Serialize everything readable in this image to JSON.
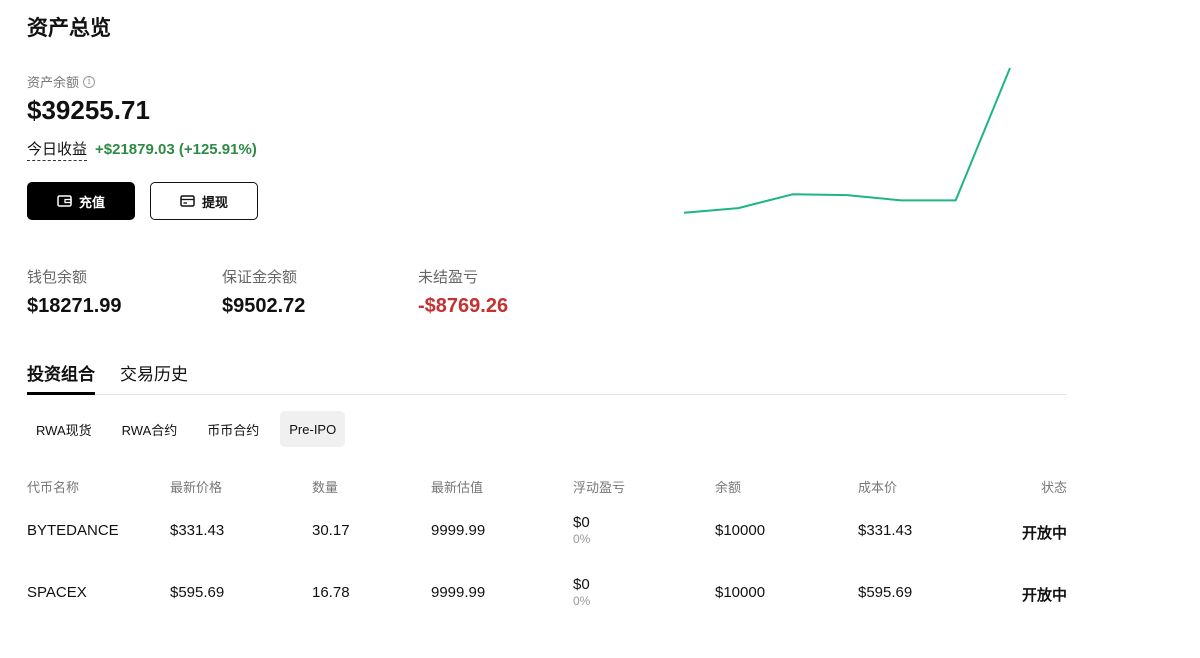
{
  "page": {
    "title": "资产总览"
  },
  "balance": {
    "label": "资产余额",
    "info_icon": "i",
    "value": "$39255.71",
    "today_pnl_label": "今日收益",
    "today_pnl_value": "+$21879.03 (+125.91%)"
  },
  "actions": {
    "deposit_label": "充值",
    "withdraw_label": "提现"
  },
  "stats": {
    "wallet_label": "钱包余额",
    "wallet_value": "$18271.99",
    "margin_label": "保证金余额",
    "margin_value": "$9502.72",
    "unrealized_label": "未结盈亏",
    "unrealized_value": "-$8769.26"
  },
  "colors": {
    "positive": "#2e8b45",
    "negative": "#c53030",
    "sparkline": "#1db588"
  },
  "sparkline": {
    "values": [
      0.06,
      0.09,
      0.18,
      0.175,
      0.14,
      0.14,
      1.0
    ]
  },
  "tabs": [
    {
      "label": "投资组合",
      "active": true
    },
    {
      "label": "交易历史",
      "active": false
    }
  ],
  "subtabs": [
    {
      "label": "RWA现货",
      "active": false
    },
    {
      "label": "RWA合约",
      "active": false
    },
    {
      "label": "币币合约",
      "active": false
    },
    {
      "label": "Pre-IPO",
      "active": true
    }
  ],
  "table": {
    "headers": [
      "代币名称",
      "最新价格",
      "数量",
      "最新估值",
      "浮动盈亏",
      "余额",
      "成本价",
      "状态"
    ],
    "rows": [
      {
        "name": "BYTEDANCE",
        "price": "$331.43",
        "qty": "30.17",
        "valuation": "9999.99",
        "pnl": "$0",
        "pnl_pct": "0%",
        "balance": "$10000",
        "cost": "$331.43",
        "status": "开放中"
      },
      {
        "name": "SPACEX",
        "price": "$595.69",
        "qty": "16.78",
        "valuation": "9999.99",
        "pnl": "$0",
        "pnl_pct": "0%",
        "balance": "$10000",
        "cost": "$595.69",
        "status": "开放中"
      }
    ]
  }
}
